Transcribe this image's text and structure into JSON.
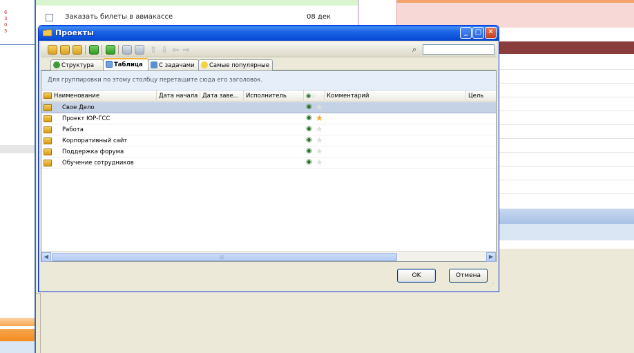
{
  "background": {
    "left_numbers": [
      "6",
      "3",
      "0",
      "5"
    ],
    "task_text": "Заказать билеты в авиакассе",
    "task_date": "08 дек"
  },
  "dialog": {
    "title": "Проекты",
    "tabs": [
      {
        "label": "Структура",
        "icon": "tree-icon",
        "active": false
      },
      {
        "label": "Таблица",
        "icon": "table-icon",
        "active": true
      },
      {
        "label": "С задачами",
        "icon": "tasks-icon",
        "active": false
      },
      {
        "label": "Самые популярные",
        "icon": "smiley-icon",
        "active": false
      }
    ],
    "group_hint": "Для группировки по этому столбцу перетащите сюда его заголовок.",
    "columns": [
      "Наименование",
      "Дата начала",
      "Дата заве...",
      "Исполнитель",
      "Комментарий",
      "Цель"
    ],
    "rows": [
      {
        "name": "Свое Дело",
        "favorite": false,
        "selected": true
      },
      {
        "name": "Проект ЮР-ГСС",
        "favorite": true,
        "selected": false
      },
      {
        "name": "Работа",
        "favorite": false,
        "selected": false
      },
      {
        "name": "Корпоративный сайт",
        "favorite": false,
        "selected": false
      },
      {
        "name": "Поддержка форума",
        "favorite": false,
        "selected": false
      },
      {
        "name": "Обучение сотрудников",
        "favorite": false,
        "selected": false
      }
    ],
    "buttons": {
      "ok": "OK",
      "cancel": "Отмена"
    },
    "colors": {
      "title_bar": "#0a4fd8",
      "selection": "#c5d1e4",
      "star_on": "#f0a81c",
      "group_panel": "#e6eef9"
    }
  }
}
